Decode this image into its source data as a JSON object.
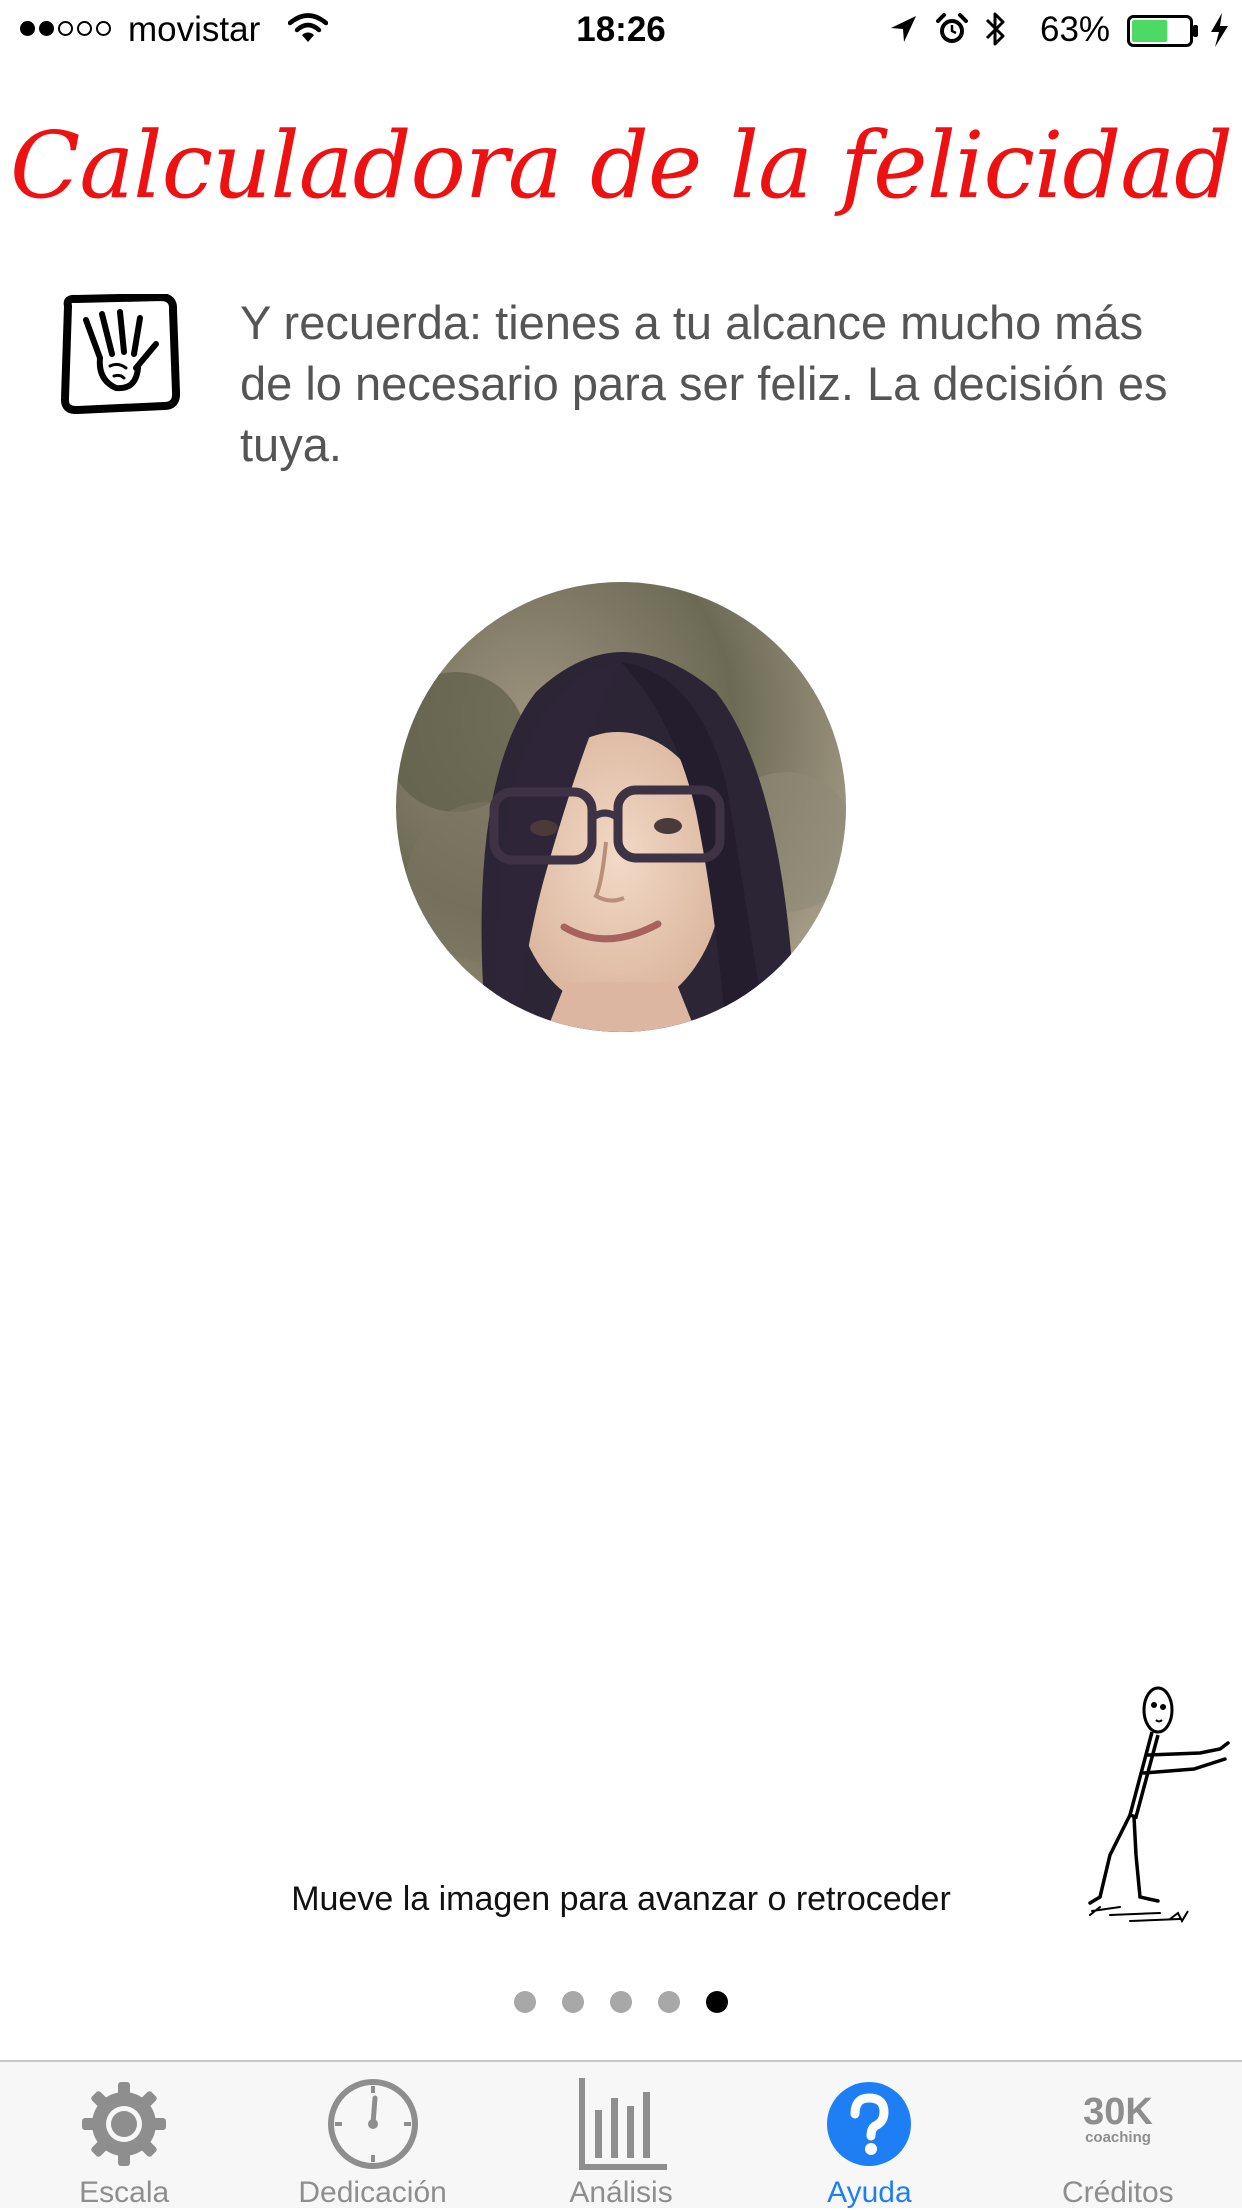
{
  "status_bar": {
    "carrier": "movistar",
    "time": "18:26",
    "battery_percent": "63%",
    "battery_level": 0.63,
    "signal_bars": 2,
    "signal_total": 5
  },
  "header": {
    "title": "Calculadora de la felicidad",
    "title_color": "#ee1111"
  },
  "content": {
    "message": "Y recuerda: tienes a tu alcance mucho más de lo necesario para ser feliz. La decisión es tuya.",
    "hint": "Mueve la imagen para avanzar o retroceder"
  },
  "pager": {
    "total": 5,
    "active_index": 4
  },
  "tabs": [
    {
      "label": "Escala",
      "icon": "gear-icon",
      "active": false
    },
    {
      "label": "Dedicación",
      "icon": "clock-icon",
      "active": false
    },
    {
      "label": "Análisis",
      "icon": "bar-chart-icon",
      "active": false
    },
    {
      "label": "Ayuda",
      "icon": "help-icon",
      "active": true
    },
    {
      "label": "Créditos",
      "icon": "30k-coaching-logo",
      "logo_text": "30K",
      "logo_subtext": "coaching",
      "active": false
    }
  ],
  "colors": {
    "accent": "#1e7ff5",
    "inactive_tab": "#8e8e8e",
    "battery": "#4cd964"
  }
}
